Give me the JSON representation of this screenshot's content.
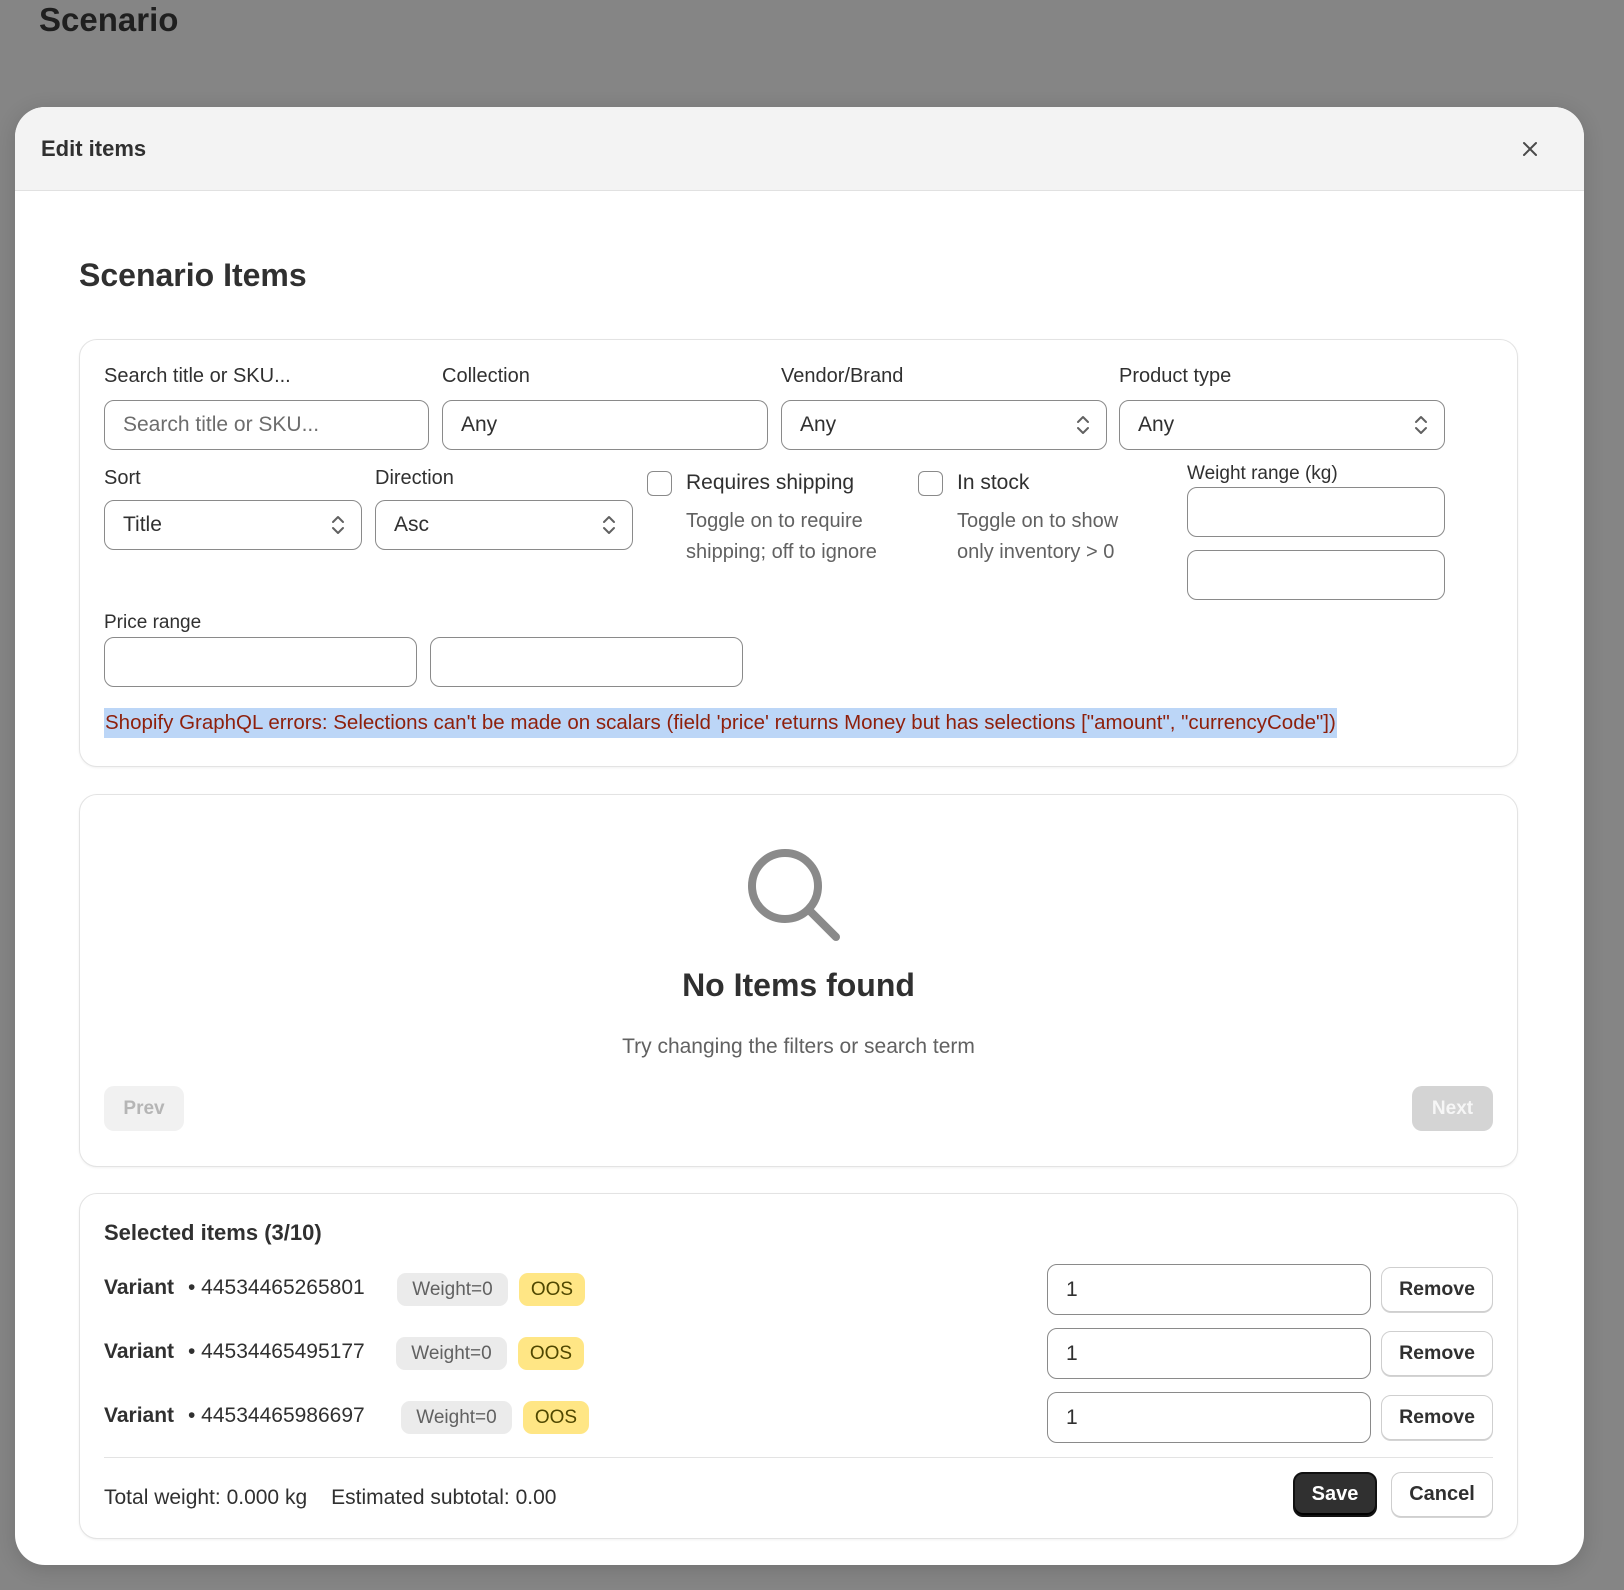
{
  "page": {
    "title": "Scenario"
  },
  "modal": {
    "title": "Edit items",
    "close_icon": "close-icon",
    "section_title": "Scenario Items"
  },
  "filters": {
    "search": {
      "label": "Search title or SKU...",
      "placeholder": "Search title or SKU...",
      "value": ""
    },
    "collection": {
      "label": "Collection",
      "value": "Any"
    },
    "vendor": {
      "label": "Vendor/Brand",
      "value": "Any"
    },
    "product_type": {
      "label": "Product type",
      "value": "Any"
    },
    "sort": {
      "label": "Sort",
      "value": "Title"
    },
    "direction": {
      "label": "Direction",
      "value": "Asc"
    },
    "requires_shipping": {
      "label": "Requires shipping",
      "checked": false,
      "help": "Toggle on to require shipping; off to ignore"
    },
    "in_stock": {
      "label": "In stock",
      "checked": false,
      "help": "Toggle on to show only inventory > 0"
    },
    "weight_range": {
      "label": "Weight range (kg)",
      "min": "",
      "max": ""
    },
    "price_range": {
      "label": "Price range",
      "min": "",
      "max": ""
    },
    "error": "Shopify GraphQL errors: Selections can't be made on scalars (field 'price' returns Money but has selections [\"amount\", \"currencyCode\"])"
  },
  "results": {
    "icon": "search-icon",
    "empty_title": "No Items found",
    "empty_subtitle": "Try changing the filters or search term",
    "prev_label": "Prev",
    "next_label": "Next"
  },
  "selected": {
    "title": "Selected items (3/10)",
    "items": [
      {
        "name": "Variant",
        "id": "• 44534465265801",
        "weight_badge": "Weight=0",
        "stock_badge": "OOS",
        "qty": "1",
        "remove_label": "Remove"
      },
      {
        "name": "Variant",
        "id": "• 44534465495177",
        "weight_badge": "Weight=0",
        "stock_badge": "OOS",
        "qty": "1",
        "remove_label": "Remove"
      },
      {
        "name": "Variant",
        "id": "• 44534465986697",
        "weight_badge": "Weight=0",
        "stock_badge": "OOS",
        "qty": "1",
        "remove_label": "Remove"
      }
    ],
    "total_weight": "Total weight: 0.000 kg",
    "estimated_subtotal": "Estimated subtotal: 0.00",
    "save_label": "Save",
    "cancel_label": "Cancel"
  },
  "colors": {
    "backdrop": "#858585",
    "error_text": "#8e1f0b",
    "error_highlight": "#bcd6f7",
    "oos_badge": "#ffe685",
    "primary_button": "#303030"
  }
}
